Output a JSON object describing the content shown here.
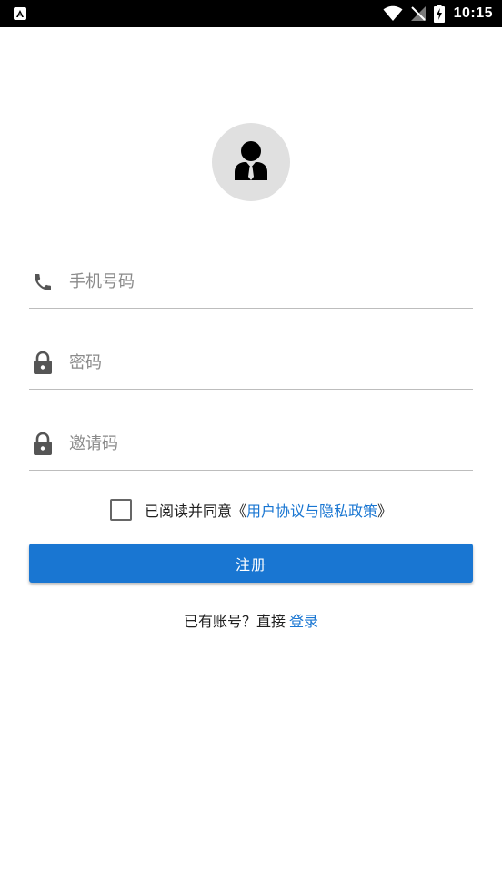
{
  "status_bar": {
    "time": "10:15",
    "icons": [
      "app-notification-icon",
      "wifi-icon",
      "no-signal-icon",
      "battery-charging-icon"
    ]
  },
  "avatar": {
    "icon": "user-avatar-icon"
  },
  "form": {
    "phone": {
      "placeholder": "手机号码",
      "value": "",
      "icon": "phone-icon"
    },
    "password": {
      "placeholder": "密码",
      "value": "",
      "icon": "lock-icon"
    },
    "invite": {
      "placeholder": "邀请码",
      "value": "",
      "icon": "lock-icon"
    }
  },
  "agreement": {
    "checked": false,
    "prefix": "已阅读并同意《",
    "link": "用户协议与隐私政策",
    "suffix": "》"
  },
  "register_button": {
    "label": "注册"
  },
  "login_prompt": {
    "text": "已有账号？直接",
    "link": "登录"
  },
  "colors": {
    "primary": "#1976d2",
    "avatar_bg": "#e0e0e0",
    "icon": "#555555"
  }
}
